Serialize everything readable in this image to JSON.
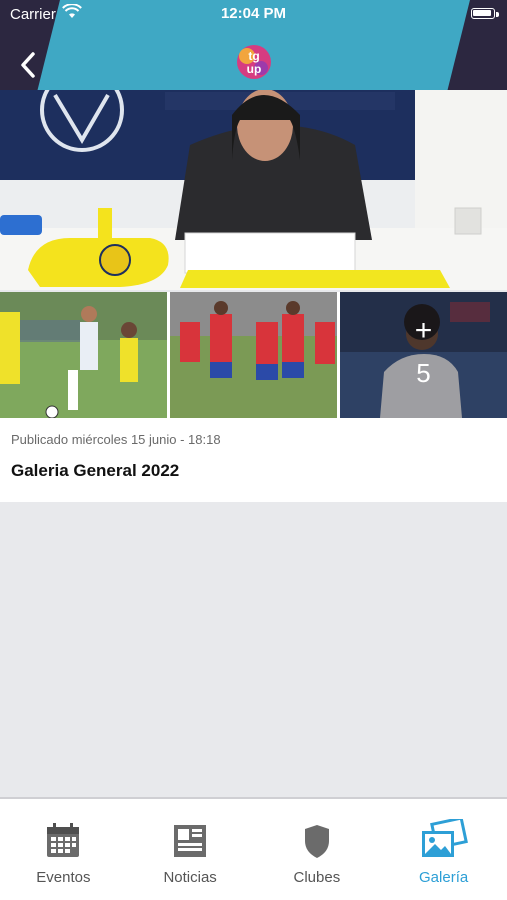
{
  "status_bar": {
    "carrier": "Carrier",
    "time": "12:04 PM"
  },
  "header": {
    "logo_text_top": "tg",
    "logo_text_bottom": "up"
  },
  "gallery": {
    "more_symbol": "+",
    "more_count": "5"
  },
  "post": {
    "published": "Publicado miércoles 15 junio - 18:18",
    "title": "Galeria General 2022"
  },
  "tabs": [
    {
      "label": "Eventos",
      "icon": "calendar-icon"
    },
    {
      "label": "Noticias",
      "icon": "newspaper-icon"
    },
    {
      "label": "Clubes",
      "icon": "shield-icon"
    },
    {
      "label": "Galería",
      "icon": "gallery-icon",
      "active": true
    }
  ],
  "colors": {
    "header": "#2c2740",
    "accent_band": "#3fa8c4",
    "tab_active": "#2d9fd6",
    "background": "#e8e9ec"
  }
}
